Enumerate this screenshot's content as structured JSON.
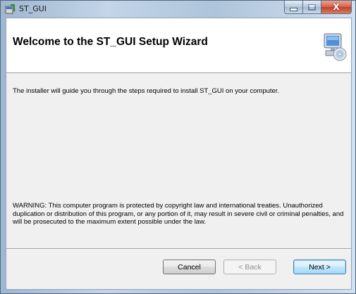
{
  "window": {
    "title": "ST_GUI"
  },
  "caption": {
    "close_glyph": "X"
  },
  "banner": {
    "heading": "Welcome to the ST_GUI Setup Wizard",
    "icon": "computer-install-icon"
  },
  "body": {
    "intro": "The installer will guide you through the steps required to install ST_GUI on your computer.",
    "warning": "WARNING: This computer program is protected by copyright law and international treaties. Unauthorized duplication or distribution of this program, or any portion of it, may result in severe civil or criminal penalties, and will be prosecuted to the maximum extent possible under the law."
  },
  "buttons": {
    "cancel": "Cancel",
    "back": "< Back",
    "next": "Next >",
    "back_enabled": false
  },
  "colors": {
    "close_button": "#c4402a",
    "default_button_border": "#3c7fb1"
  }
}
